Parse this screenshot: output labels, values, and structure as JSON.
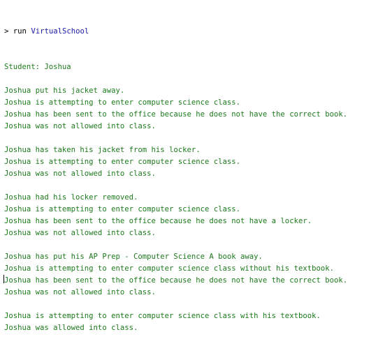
{
  "console": {
    "prompt_symbol": ">",
    "command_keyword": "run",
    "command_target": "VirtualSchool",
    "output_blocks": [
      [
        "Student: Joshua"
      ],
      [
        "Joshua put his jacket away.",
        "Joshua is attempting to enter computer science class.",
        "Joshua has been sent to the office because he does not have the correct book.",
        "Joshua was not allowed into class."
      ],
      [
        "Joshua has taken his jacket from his locker.",
        "Joshua is attempting to enter computer science class.",
        "Joshua was not allowed into class."
      ],
      [
        "Joshua had his locker removed.",
        "Joshua is attempting to enter computer science class.",
        "Joshua has been sent to the office because he does not have a locker.",
        "Joshua was not allowed into class."
      ],
      [
        "Joshua has put his AP Prep - Computer Science A book away.",
        "Joshua is attempting to enter computer science class without his textbook.",
        "Joshua has been sent to the office because he does not have the correct book.",
        "Joshua was not allowed into class."
      ],
      [
        "Joshua is attempting to enter computer science class with his textbook.",
        "Joshua was allowed into class."
      ]
    ]
  }
}
